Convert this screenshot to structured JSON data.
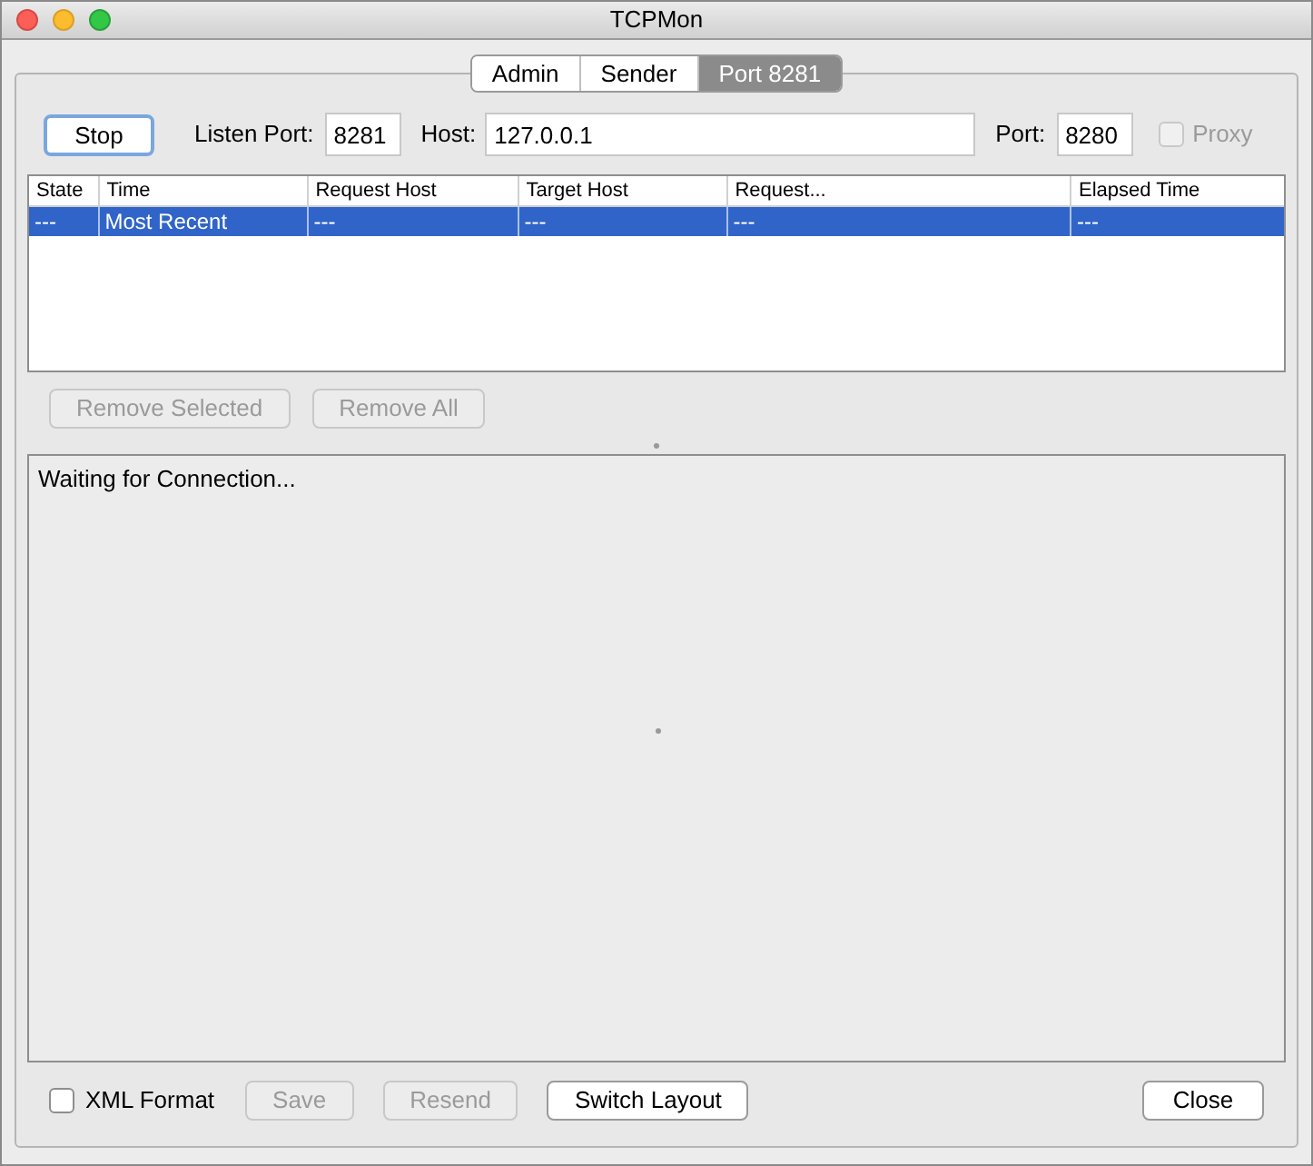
{
  "window": {
    "title": "TCPMon"
  },
  "tabs": [
    {
      "label": "Admin",
      "selected": false
    },
    {
      "label": "Sender",
      "selected": false
    },
    {
      "label": "Port 8281",
      "selected": true
    }
  ],
  "listener": {
    "stop_button": "Stop",
    "listen_port_label": "Listen Port:",
    "listen_port": "8281",
    "host_label": "Host:",
    "host": "127.0.0.1",
    "port_label": "Port:",
    "port": "8280",
    "proxy": {
      "label": "Proxy",
      "checked": false,
      "disabled": true
    }
  },
  "table": {
    "columns": [
      "State",
      "Time",
      "Request Host",
      "Target Host",
      "Request...",
      "Elapsed Time"
    ],
    "rows": [
      {
        "cells": [
          "---",
          "Most Recent",
          "---",
          "---",
          "---",
          "---"
        ],
        "selected": true
      }
    ]
  },
  "table_buttons": [
    {
      "label": "Remove Selected",
      "disabled": true
    },
    {
      "label": "Remove All",
      "disabled": true
    }
  ],
  "output": "Waiting for Connection...",
  "xml_format": {
    "label": "XML Format",
    "checked": false
  },
  "bottom_buttons": [
    {
      "label": "Save",
      "disabled": true
    },
    {
      "label": "Resend",
      "disabled": true
    },
    {
      "label": "Switch Layout",
      "disabled": false
    }
  ],
  "close_button": {
    "label": "Close",
    "disabled": false
  }
}
